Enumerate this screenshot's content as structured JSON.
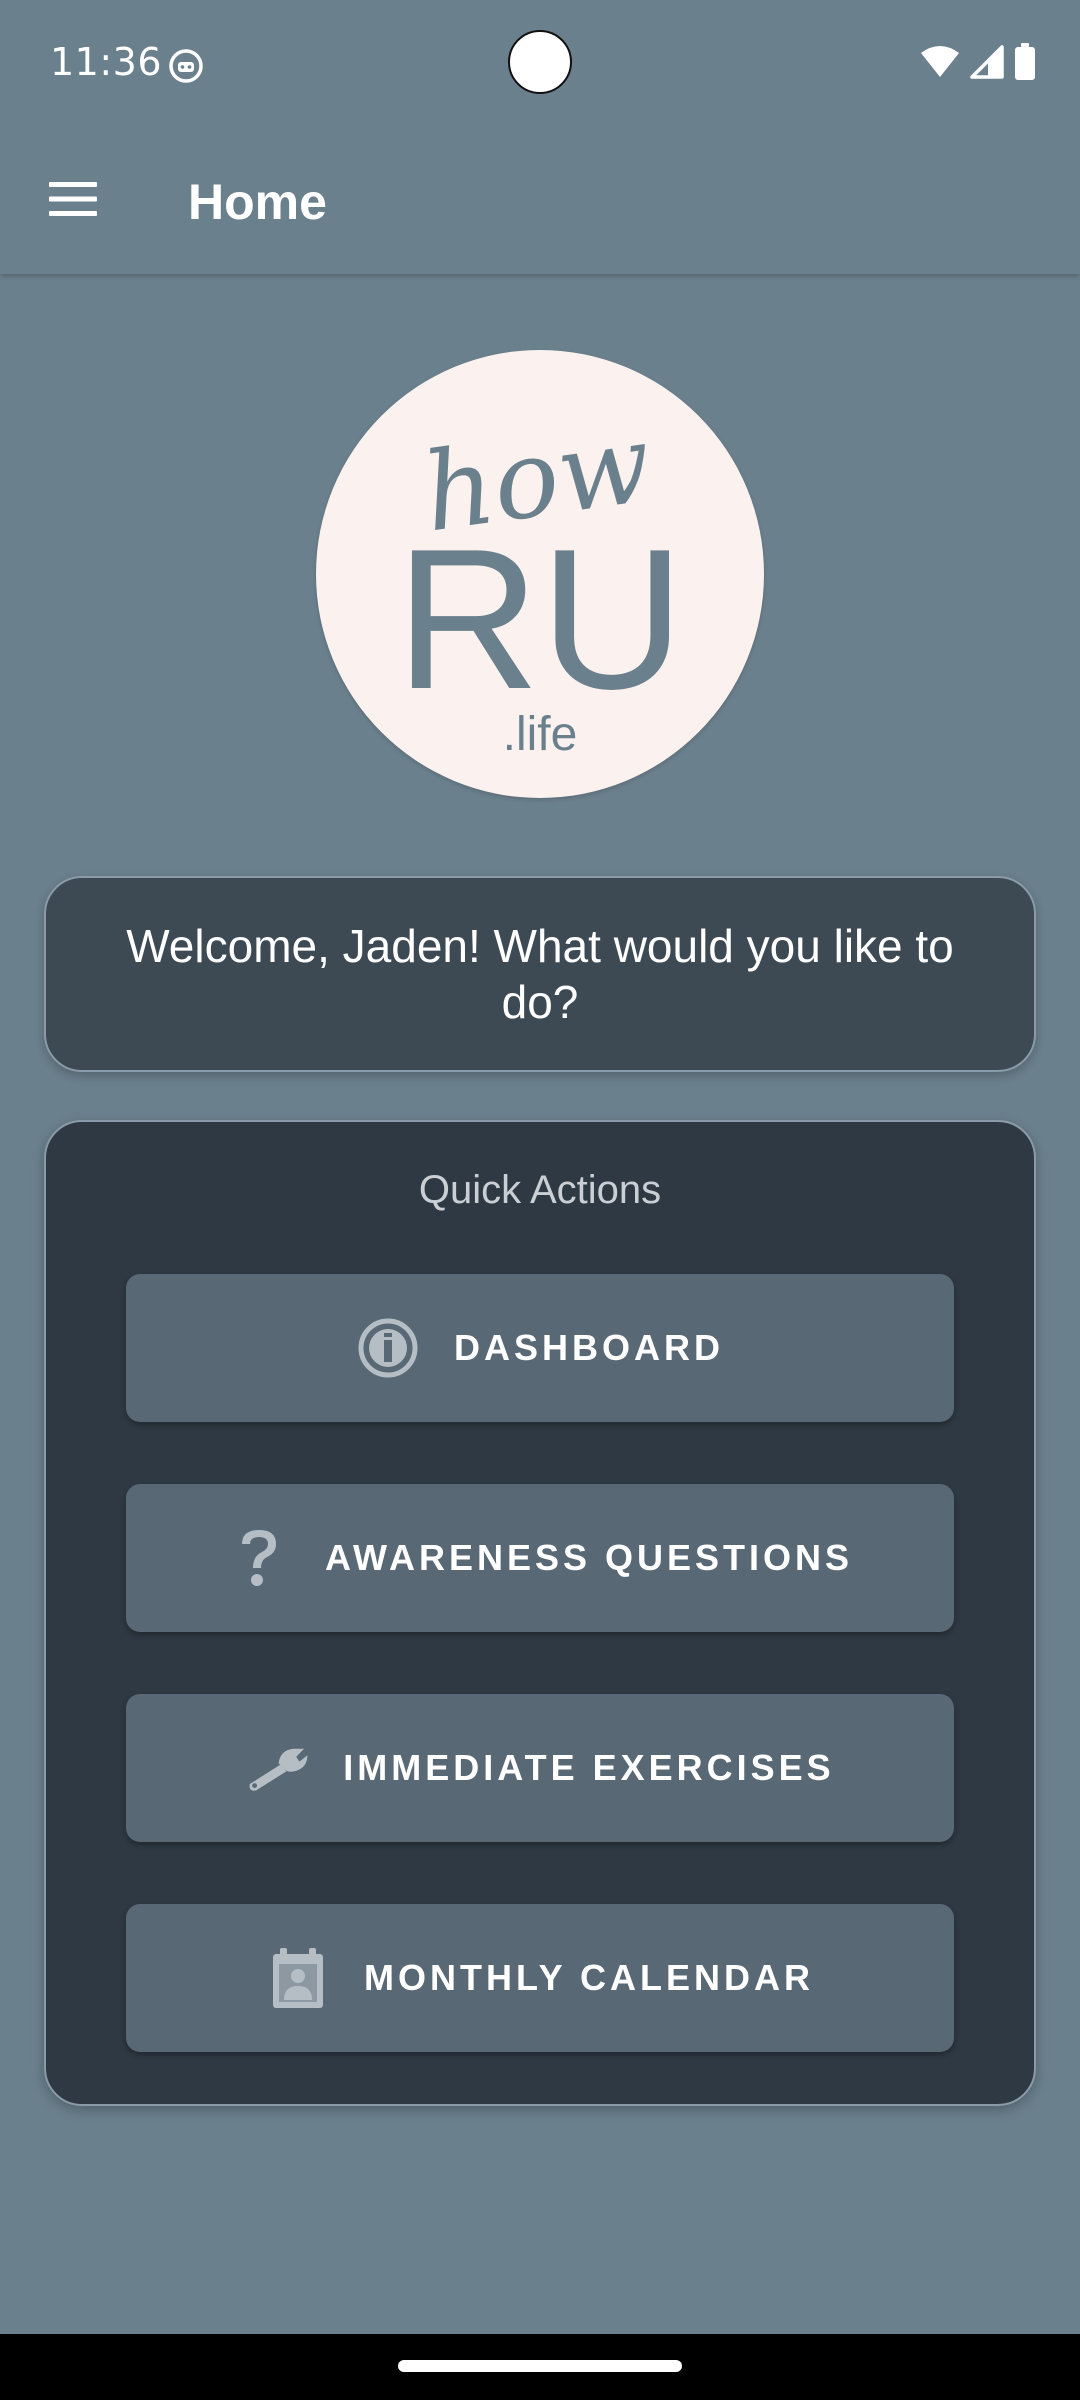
{
  "status_bar": {
    "time": "11:36",
    "icons": [
      "app-notification-icon",
      "wifi-icon",
      "cellular-signal-icon",
      "battery-icon"
    ]
  },
  "app_bar": {
    "title": "Home",
    "menu_icon": "hamburger-menu-icon"
  },
  "logo": {
    "line1": "how",
    "line2": "RU",
    "line3": ".life"
  },
  "welcome": {
    "text": "Welcome, Jaden! What would you like to do?"
  },
  "quick_actions": {
    "title": "Quick Actions",
    "buttons": [
      {
        "label": "DASHBOARD",
        "icon": "info-icon"
      },
      {
        "label": "AWARENESS QUESTIONS",
        "icon": "question-mark-icon"
      },
      {
        "label": "IMMEDIATE EXERCISES",
        "icon": "wrench-icon"
      },
      {
        "label": "MONTHLY CALENDAR",
        "icon": "calendar-person-icon"
      }
    ]
  },
  "colors": {
    "background": "#6b808d",
    "welcome_card": "#3d4a54",
    "quick_card": "#2f3943",
    "button": "#586874",
    "logo_bg": "#fbf1ee",
    "logo_ink": "#6b808d"
  }
}
